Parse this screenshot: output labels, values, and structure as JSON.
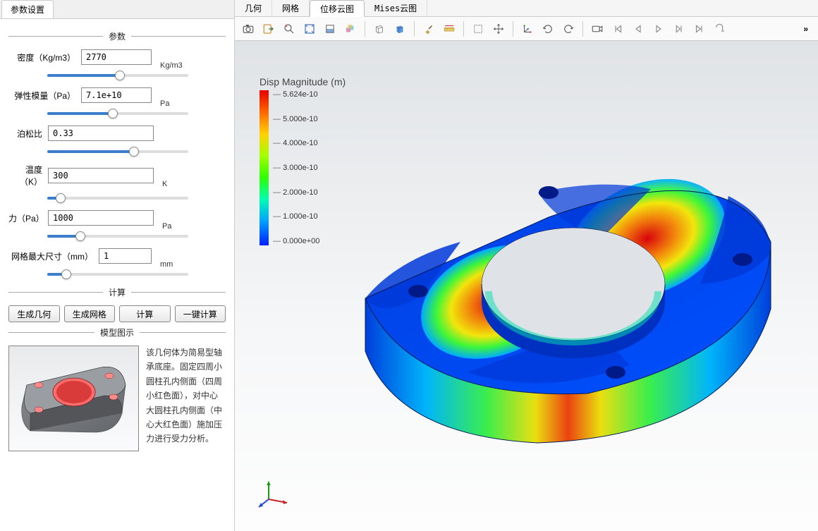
{
  "left_tab": "参数设置",
  "section_params": "参数",
  "section_calc": "计算",
  "section_model": "模型图示",
  "params": {
    "density": {
      "label": "密度（Kg/m3）",
      "value": "2770",
      "unit": "Kg/m3"
    },
    "elastic": {
      "label": "弹性模量（Pa）",
      "value": "7.1e+10",
      "unit": "Pa"
    },
    "poisson": {
      "label": "泊松比",
      "value": "0.33",
      "unit": ""
    },
    "temp": {
      "label": "温度（K）",
      "value": "300",
      "unit": "K"
    },
    "force": {
      "label": "力（Pa）",
      "value": "1000",
      "unit": "Pa"
    },
    "mesh": {
      "label": "网格最大尺寸（mm）",
      "value": "1",
      "unit": "mm"
    }
  },
  "buttons": {
    "gen_geom": "生成几何",
    "gen_mesh": "生成网格",
    "calc": "计算",
    "one_click": "一键计算"
  },
  "model_desc": "该几何体为简易型轴承底座。固定四周小圆柱孔内侧面（四周小红色面），对中心大圆柱孔内侧面（中心大红色面）施加压力进行受力分析。",
  "main_tabs": {
    "geom": "几何",
    "mesh": "网格",
    "disp": "位移云图",
    "mises": "Mises云图"
  },
  "legend": {
    "title": "Disp Magnitude (m)",
    "values": [
      "5.624e-10",
      "5.000e-10",
      "4.000e-10",
      "3.000e-10",
      "2.000e-10",
      "1.000e-10",
      "0.000e+00"
    ]
  },
  "more": "»"
}
